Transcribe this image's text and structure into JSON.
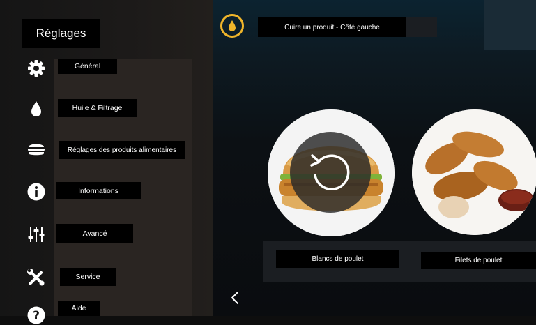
{
  "sidebar": {
    "title": "Réglages",
    "items": [
      {
        "label": "Général",
        "icon": "gear-icon"
      },
      {
        "label": "Huile & Filtrage",
        "icon": "oil-drop-icon"
      },
      {
        "label": "Réglages des produits alimentaires",
        "icon": "burger-icon"
      },
      {
        "label": "Informations",
        "icon": "info-icon"
      },
      {
        "label": "Avancé",
        "icon": "sliders-icon"
      },
      {
        "label": "Service",
        "icon": "tools-icon"
      },
      {
        "label": "Aide",
        "icon": "help-icon"
      }
    ]
  },
  "header": {
    "title": "Cuire un produit - Côté gauche",
    "status_icon": "oil-drop-icon",
    "accent_color": "#f0b52a"
  },
  "products": [
    {
      "label": "Blancs de poulet",
      "image": "chicken-sandwich-image"
    },
    {
      "label": "Filets de poulet",
      "image": "chicken-tenders-image"
    }
  ]
}
